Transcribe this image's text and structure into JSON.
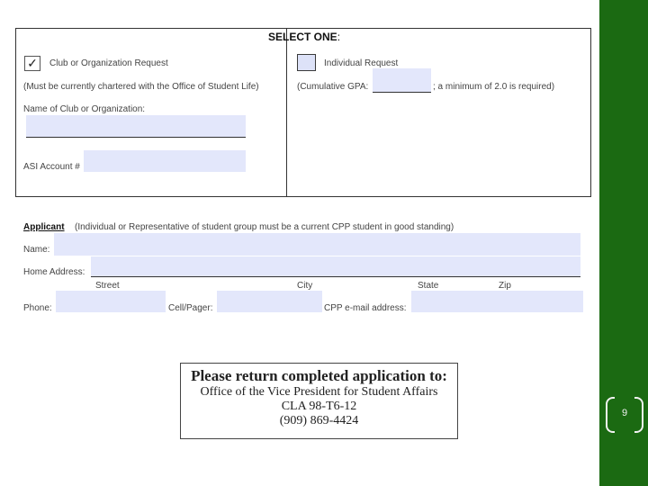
{
  "form": {
    "select_heading": "SELECT ONE",
    "select_colon": ":",
    "club_label": "Club or Organization Request",
    "club_checkmark": "✓",
    "club_note": "(Must be currently chartered with the Office of Student Life)",
    "club_name_label": "Name of Club or Organization:",
    "asi_label": "ASI Account #",
    "individual_label": "Individual Request",
    "gpa_label": "(Cumulative GPA:",
    "gpa_suffix": "; a minimum of 2.0 is required)",
    "applicant_heading": "Applicant",
    "applicant_note": "(Individual or Representative of student group must be a current CPP student in good standing)",
    "name_label": "Name:",
    "home_address_label": "Home Address:",
    "street_label": "Street",
    "city_label": "City",
    "state_label": "State",
    "zip_label": "Zip",
    "phone_label": "Phone:",
    "cell_label": "Cell/Pager:",
    "email_label": "CPP e-mail address:"
  },
  "return_box": {
    "heading": "Please return completed application to:",
    "lines": [
      "Office of the Vice President for Student Affairs",
      "CLA 98-T6-12",
      "(909) 869-4424"
    ]
  },
  "slide": {
    "page_number": "9",
    "accent_color": "#1b6a12"
  }
}
